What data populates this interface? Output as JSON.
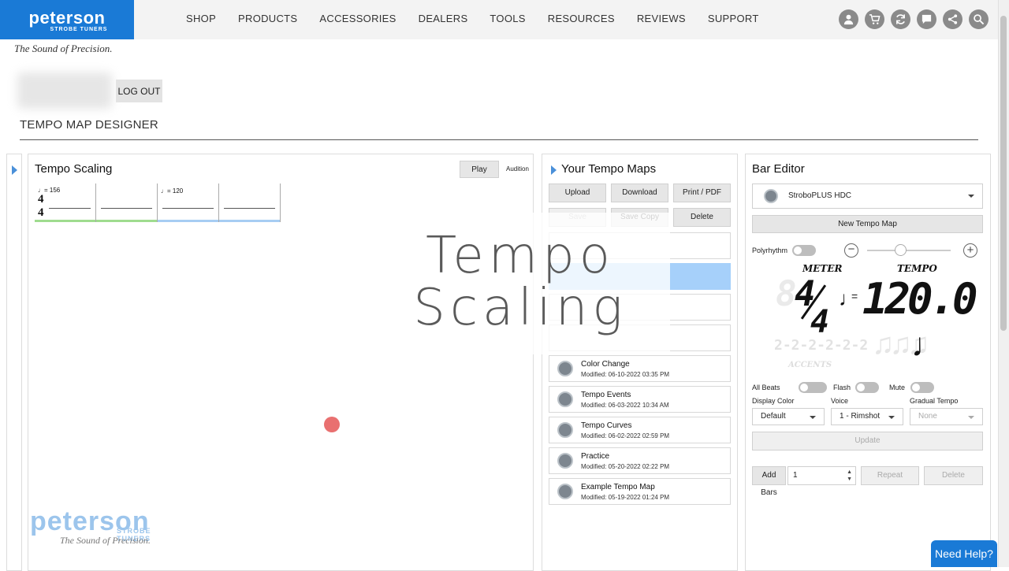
{
  "brand": {
    "name": "peterson",
    "subtitle": "STROBE TUNERS",
    "tagline": "The Sound of Precision."
  },
  "nav": [
    "SHOP",
    "PRODUCTS",
    "ACCESSORIES",
    "DEALERS",
    "TOOLS",
    "RESOURCES",
    "REVIEWS",
    "SUPPORT"
  ],
  "nav_icons": [
    "user-icon",
    "cart-icon",
    "sync-icon",
    "chat-icon",
    "share-icon",
    "search-icon"
  ],
  "account": {
    "logout_label": "LOG OUT"
  },
  "page_title": "TEMPO MAP DESIGNER",
  "scaling_panel": {
    "title": "Tempo Scaling",
    "play_label": "Play",
    "audition_label": "Audition",
    "time_signature_top": "4",
    "time_signature_bottom": "4",
    "measures": [
      {
        "tempo": "♩= 156",
        "color": "#9fdc8f"
      },
      {
        "tempo": "",
        "color": "#9fdc8f"
      },
      {
        "tempo": "♩= 120",
        "color": "#a7cdf3"
      },
      {
        "tempo": "",
        "color": "#a7cdf3"
      }
    ]
  },
  "overlay_text": [
    "Tempo",
    "Scaling"
  ],
  "maps_panel": {
    "title": "Your Tempo Maps",
    "buttons": {
      "upload": "Upload",
      "download": "Download",
      "print": "Print / PDF",
      "save": "Save",
      "save_copy": "Save Copy",
      "delete": "Delete"
    },
    "items": [
      {
        "name": "Color Change",
        "modified": "Modified: 06-10-2022 03:35 PM"
      },
      {
        "name": "Tempo Events",
        "modified": "Modified: 06-03-2022 10:34 AM"
      },
      {
        "name": "Tempo Curves",
        "modified": "Modified: 06-02-2022 02:59 PM"
      },
      {
        "name": "Practice",
        "modified": "Modified: 05-20-2022 02:22 PM"
      },
      {
        "name": "Example Tempo Map",
        "modified": "Modified: 05-19-2022 01:24 PM"
      }
    ]
  },
  "editor": {
    "title": "Bar Editor",
    "device": "StroboPLUS HDC",
    "new_map_label": "New Tempo Map",
    "polyrhythm_label": "Polyrhythm",
    "meter_label": "METER",
    "tempo_label": "TEMPO",
    "meter_top": "4",
    "meter_bottom": "4",
    "tempo_value": "120.0",
    "accents_label": "ACCENTS",
    "all_beats_label": "All Beats",
    "flash_label": "Flash",
    "mute_label": "Mute",
    "display_color_label": "Display Color",
    "display_color_value": "Default",
    "voice_label": "Voice",
    "voice_value": "1 - Rimshot",
    "gradual_tempo_label": "Gradual Tempo",
    "gradual_tempo_value": "None",
    "update_label": "Update",
    "add_bars_label": "Add Bars",
    "add_bars_value": "1",
    "repeat_label": "Repeat",
    "delete_label": "Delete"
  },
  "help_label": "Need Help?",
  "watermark": {
    "name": "peterson",
    "subtitle": "STROBE TUNERS",
    "tagline": "The Sound of Precision."
  }
}
